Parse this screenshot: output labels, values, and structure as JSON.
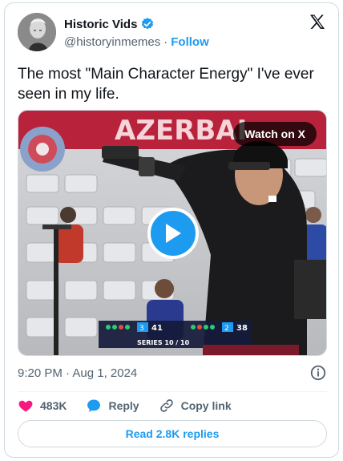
{
  "author": {
    "display_name": "Historic Vids",
    "handle": "@historyinmemes",
    "separator": "·",
    "follow_label": "Follow"
  },
  "tweet": {
    "text": "The most \"Main Character Energy\" I've ever seen in my life.",
    "timestamp": "9:20 PM · Aug 1, 2024"
  },
  "media": {
    "watch_label": "Watch on X",
    "banner_text": "AZERBAI",
    "scoreboard": {
      "series_label": "SERIES 10 / 10",
      "left_score": "41",
      "right_score": "38",
      "left_rank": "3",
      "right_rank": "2"
    }
  },
  "actions": {
    "like_count": "483K",
    "reply_label": "Reply",
    "copy_link_label": "Copy link"
  },
  "read_replies_label": "Read 2.8K replies",
  "colors": {
    "accent": "#1d9bf0",
    "like": "#f91880",
    "text_primary": "#0f1419",
    "text_secondary": "#536471",
    "border": "#cfd9de"
  }
}
